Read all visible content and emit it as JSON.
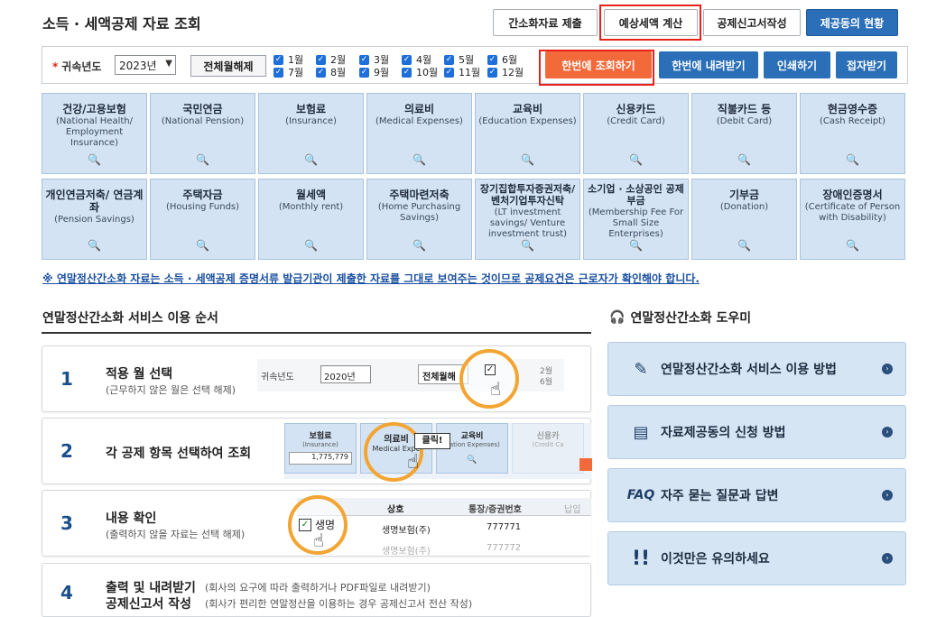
{
  "header": {
    "title": "소득 · 세액공제 자료 조회",
    "buttons": {
      "simple_payment": "간소화자료 제출",
      "tax_estimate": "예상세액 계산",
      "deduction_form": "공제신고서작성",
      "provider_status": "제공동의 현황"
    }
  },
  "filter": {
    "year_label": "귀속년도",
    "year_value": "2023년",
    "deselect_all": "전체월해제",
    "months": [
      "1월",
      "2월",
      "3월",
      "4월",
      "5월",
      "6월",
      "7월",
      "8월",
      "9월",
      "10월",
      "11월",
      "12월"
    ],
    "actions": {
      "query_all": "한번에 조회하기",
      "download_all": "한번에 내려받기",
      "print": "인쇄하기",
      "email": "접자받기"
    }
  },
  "categories": [
    {
      "ko": "건강/고용보험",
      "en": "(National Health/ Employment Insurance)"
    },
    {
      "ko": "국민연금",
      "en": "(National Pension)"
    },
    {
      "ko": "보험료",
      "en": "(Insurance)"
    },
    {
      "ko": "의료비",
      "en": "(Medical Expenses)"
    },
    {
      "ko": "교육비",
      "en": "(Education Expenses)"
    },
    {
      "ko": "신용카드",
      "en": "(Credit Card)"
    },
    {
      "ko": "직불카드 등",
      "en": "(Debit Card)"
    },
    {
      "ko": "현금영수증",
      "en": "(Cash Receipt)"
    },
    {
      "ko": "개인연금저축/ 연금계좌",
      "en": "(Pension Savings)"
    },
    {
      "ko": "주택자금",
      "en": "(Housing Funds)"
    },
    {
      "ko": "월세액",
      "en": "(Monthly rent)"
    },
    {
      "ko": "주택마련저축",
      "en": "(Home Purchasing Savings)"
    },
    {
      "ko": "장기집합투자증권저축/ 벤처기업투자신탁",
      "en": "(LT investment savings/ Venture investment trust)"
    },
    {
      "ko": "소기업 · 소상공인 공제부금",
      "en": "(Membership Fee For Small Size Enterprises)"
    },
    {
      "ko": "기부금",
      "en": "(Donation)"
    },
    {
      "ko": "장애인증명서",
      "en": "(Certificate of Person with Disability)"
    }
  ],
  "notice": "※ 연말정산간소화 자료는 소득 · 세액공제 증명서류 발급기관이 제출한 자료를 그대로 보여주는 것이므로 공제요건은 근로자가 확인해야 합니다.",
  "steps_section": {
    "title": "연말정산간소화 서비스 이용 순서",
    "steps": [
      {
        "num": "1",
        "title": "적용 월 선택",
        "desc": "(근무하지 않은 월은 선택 해제)"
      },
      {
        "num": "2",
        "title": "각 공제 항목 선택하여 조회",
        "desc": ""
      },
      {
        "num": "3",
        "title": "내용 확인",
        "desc": "(출력하지 않을 자료는 선택 해제)"
      },
      {
        "num": "4",
        "title": "출력 및 내려받기",
        "desc": "(회사의 요구에 따라 출력하거나 PDF파일로 내려받기)",
        "title2": "공제신고서 작성",
        "desc2": "(회사가 편리한 연말정산을 이용하는 경우 공제신고서 전산 작성)"
      }
    ],
    "illus": {
      "s1_year_label": "귀속년도",
      "s1_year": "2020년",
      "s1_btn": "전체월해",
      "s1_m1": "1월",
      "s1_m2": "2월",
      "s1_m6": "6월",
      "s2_c1": "보험료",
      "s2_c1en": "(Insurance)",
      "s2_val": "1,775,779",
      "s2_c2": "의료비",
      "s2_c2en": "Medical Expe",
      "s2_click": "클릭!",
      "s2_c3": "교육비",
      "s2_c3en": "ication Expenses)",
      "s2_c4": "신용카",
      "s2_c4en": "(Credit Ca",
      "s3_h1": "상호",
      "s3_h2": "통장/증권번호",
      "s3_h3": "납입",
      "s3_r1": "생명",
      "s3_r1b": "생명보험(주)",
      "s3_r1c": "777771",
      "s3_r2b": "생명보험(주)",
      "s3_r2c": "777772"
    }
  },
  "helper": {
    "title": "연말정산간소화 도우미",
    "items": [
      {
        "icon": "document-pen-icon",
        "label": "연말정산간소화 서비스 이용 방법"
      },
      {
        "icon": "document-icon",
        "label": "자료제공동의 신청 방법"
      },
      {
        "icon": "faq-icon",
        "label": "자주 묻는 질문과 답변",
        "badge": "FAQ"
      },
      {
        "icon": "exclamation-icon",
        "label": "이것만은 유의하세요"
      }
    ]
  }
}
